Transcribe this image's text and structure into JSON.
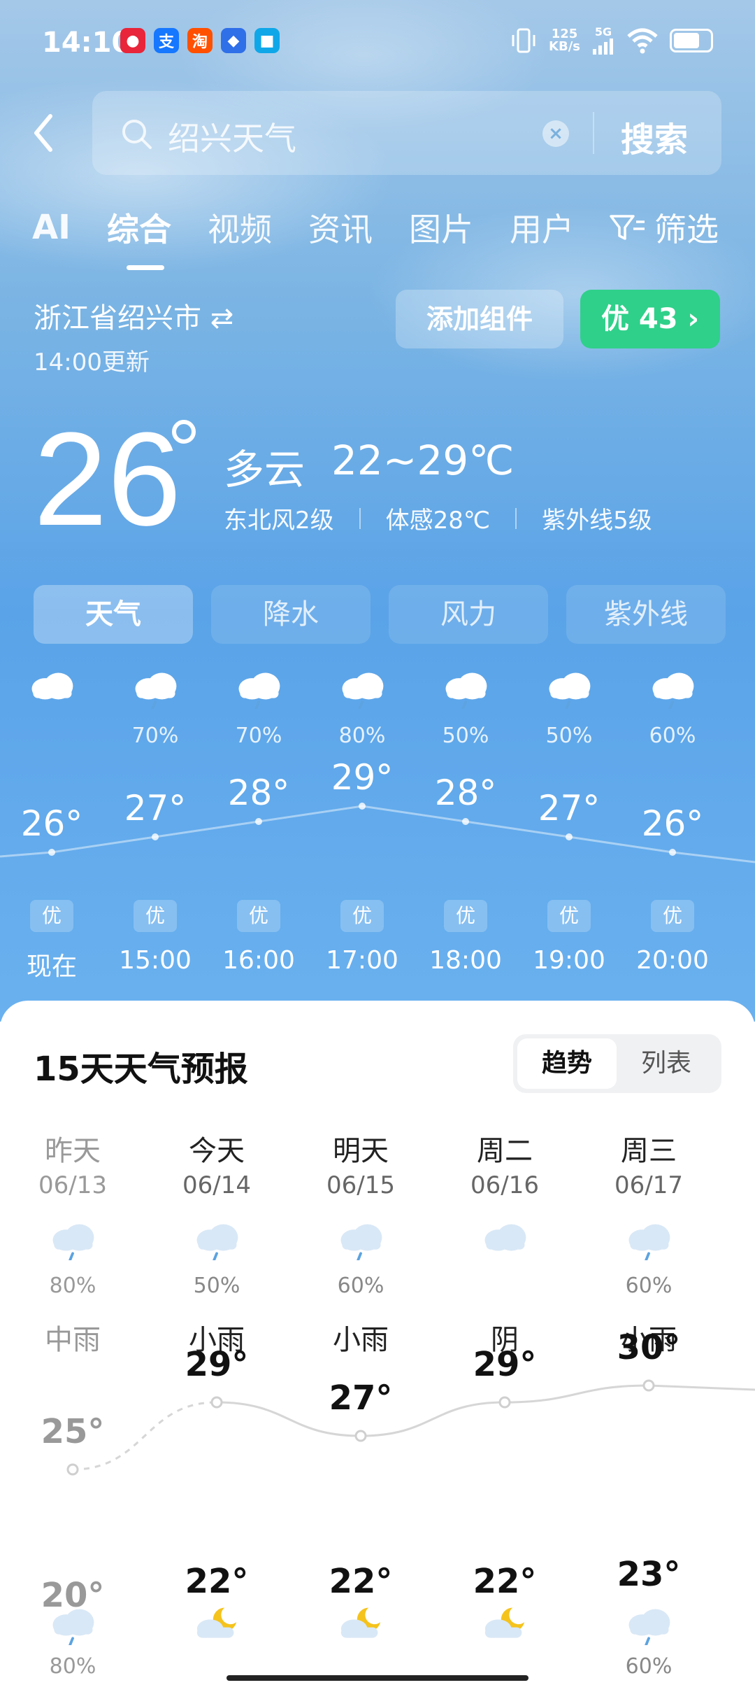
{
  "status_bar": {
    "time": "14:10",
    "net_speed_value": "125",
    "net_speed_unit": "KB/s",
    "signal_label": "5G",
    "apps": [
      {
        "name": "app-red-icon",
        "glyph": "●",
        "color": "#e8253a"
      },
      {
        "name": "alipay-icon",
        "glyph": "支",
        "color": "#1677ff"
      },
      {
        "name": "taobao-icon",
        "glyph": "淘",
        "color": "#ff5000"
      },
      {
        "name": "app-blue-icon",
        "glyph": "◆",
        "color": "#2f6fe8"
      },
      {
        "name": "app-cyan-icon",
        "glyph": "■",
        "color": "#10a7e8"
      }
    ]
  },
  "search": {
    "query": "绍兴天气",
    "button_label": "搜索"
  },
  "tabs": [
    {
      "label": "AI"
    },
    {
      "label": "综合"
    },
    {
      "label": "视频"
    },
    {
      "label": "资讯"
    },
    {
      "label": "图片"
    },
    {
      "label": "用户"
    }
  ],
  "filter_label": "筛选",
  "location": {
    "name": "浙江省绍兴市 ⇄",
    "updated": "14:00更新"
  },
  "add_widget_label": "添加组件",
  "aqi_label": "优 43 ›",
  "current": {
    "temp": "26",
    "condition": "多云",
    "range": "22~29℃",
    "wind": "东北风2级",
    "feels_like": "体感28℃",
    "uv": "紫外线5级"
  },
  "segments": [
    "天气",
    "降水",
    "风力",
    "紫外线"
  ],
  "hourly": [
    {
      "time": "现在",
      "temp": "26°",
      "precip": "",
      "aqi": "优",
      "icon": "cloudy-icon",
      "t": 26
    },
    {
      "time": "15:00",
      "temp": "27°",
      "precip": "70%",
      "aqi": "优",
      "icon": "rain-cloud-icon",
      "t": 27
    },
    {
      "time": "16:00",
      "temp": "28°",
      "precip": "70%",
      "aqi": "优",
      "icon": "rain-cloud-icon",
      "t": 28
    },
    {
      "time": "17:00",
      "temp": "29°",
      "precip": "80%",
      "aqi": "优",
      "icon": "rain-cloud-icon",
      "t": 29
    },
    {
      "time": "18:00",
      "temp": "28°",
      "precip": "50%",
      "aqi": "优",
      "icon": "rain-cloud-icon",
      "t": 28
    },
    {
      "time": "19:00",
      "temp": "27°",
      "precip": "50%",
      "aqi": "优",
      "icon": "rain-cloud-icon",
      "t": 27
    },
    {
      "time": "20:00",
      "temp": "26°",
      "precip": "60%",
      "aqi": "优",
      "icon": "rain-cloud-icon",
      "t": 26
    }
  ],
  "forecast": {
    "title": "15天天气预报",
    "toggle": [
      "趋势",
      "列表"
    ],
    "days": [
      {
        "name": "昨天",
        "date": "06/13",
        "precip": "80%",
        "condition": "中雨",
        "high": "25°",
        "low": "20°",
        "hi_n": 25,
        "lo_n": 20,
        "night_precip": "80%",
        "past": true
      },
      {
        "name": "今天",
        "date": "06/14",
        "precip": "50%",
        "condition": "小雨",
        "high": "29°",
        "low": "22°",
        "hi_n": 29,
        "lo_n": 22,
        "night_precip": "",
        "past": false
      },
      {
        "name": "明天",
        "date": "06/15",
        "precip": "60%",
        "condition": "小雨",
        "high": "27°",
        "low": "22°",
        "hi_n": 27,
        "lo_n": 22,
        "night_precip": "",
        "past": false
      },
      {
        "name": "周二",
        "date": "06/16",
        "precip": "",
        "condition": "阴",
        "high": "29°",
        "low": "22°",
        "hi_n": 29,
        "lo_n": 22,
        "night_precip": "",
        "past": false
      },
      {
        "name": "周三",
        "date": "06/17",
        "precip": "60%",
        "condition": "小雨",
        "high": "30°",
        "low": "23°",
        "hi_n": 30,
        "lo_n": 23,
        "night_precip": "60%",
        "past": false
      }
    ]
  }
}
